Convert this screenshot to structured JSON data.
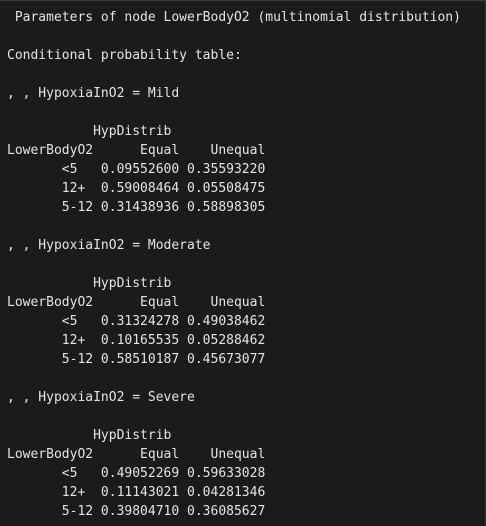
{
  "console": {
    "lines": [
      " Parameters of node LowerBodyO2 (multinomial distribution)",
      "",
      "Conditional probability table:",
      "",
      ", , HypoxiaInO2 = Mild",
      "",
      "           HypDistrib",
      "LowerBodyO2      Equal    Unequal",
      "       <5   0.09552600 0.35593220",
      "       12+  0.59008464 0.05508475",
      "       5-12 0.31438936 0.58898305",
      "",
      ", , HypoxiaInO2 = Moderate",
      "",
      "           HypDistrib",
      "LowerBodyO2      Equal    Unequal",
      "       <5   0.31324278 0.49038462",
      "       12+  0.10165535 0.05288462",
      "       5-12 0.58510187 0.45673077",
      "",
      ", , HypoxiaInO2 = Severe",
      "",
      "           HypDistrib",
      "LowerBodyO2      Equal    Unequal",
      "       <5   0.49052269 0.59633028",
      "       12+  0.11143021 0.04281346",
      "       5-12 0.39804710 0.36085627"
    ]
  }
}
